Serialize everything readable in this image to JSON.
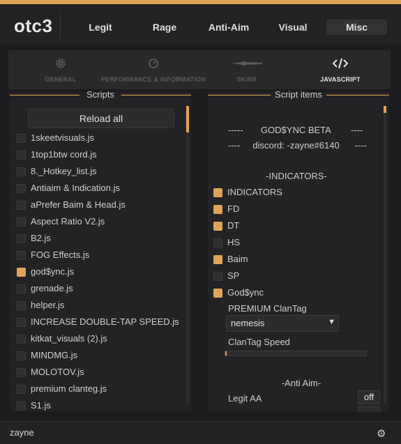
{
  "app": {
    "name": "otc3",
    "accent": "#e0a458"
  },
  "tabs": [
    {
      "label": "Legit"
    },
    {
      "label": "Rage"
    },
    {
      "label": "Anti-Aim"
    },
    {
      "label": "Visual"
    },
    {
      "label": "Misc",
      "active": true
    }
  ],
  "subnav": [
    {
      "label": "GENERAL",
      "icon": "gear-icon"
    },
    {
      "label": "PERFORMANCE & INFORMATION",
      "icon": "gauge-icon"
    },
    {
      "label": "SKINS",
      "icon": "knife-icon"
    },
    {
      "label": "JAVASCRIPT",
      "icon": "code-icon",
      "active": true
    }
  ],
  "scripts_panel": {
    "title": "Scripts",
    "reload_label": "Reload all",
    "scroll_position": 0.0,
    "items": [
      {
        "label": "1skeetvisuals.js",
        "checked": false
      },
      {
        "label": "1top1btw cord.js",
        "checked": false
      },
      {
        "label": "8._Hotkey_list.js",
        "checked": false
      },
      {
        "label": "Antiaim & Indication.js",
        "checked": false
      },
      {
        "label": "aPrefer Baim & Head.js",
        "checked": false
      },
      {
        "label": "Aspect Ratio V2.js",
        "checked": false
      },
      {
        "label": "B2.js",
        "checked": false
      },
      {
        "label": "FOG Effects.js",
        "checked": false
      },
      {
        "label": "god$ync.js",
        "checked": true
      },
      {
        "label": "grenade.js",
        "checked": false
      },
      {
        "label": "helper.js",
        "checked": false
      },
      {
        "label": "INCREASE DOUBLE-TAP SPEED.js",
        "checked": false
      },
      {
        "label": "kitkat_visuals (2).js",
        "checked": false
      },
      {
        "label": "MINDMG.js",
        "checked": false
      },
      {
        "label": "MOLOTOV.js",
        "checked": false
      },
      {
        "label": "premium clanteg.js",
        "checked": false
      },
      {
        "label": "S1.js",
        "checked": false
      }
    ]
  },
  "items_panel": {
    "title": "Script items",
    "header_line1": "-----       GOD$YNC BETA        ----",
    "header_line2": "----     discord: -zayne#6140      ----",
    "indicators_header": "-INDICATORS-",
    "indicators": [
      {
        "label": "INDICATORS",
        "checked": true
      },
      {
        "label": "FD",
        "checked": true
      },
      {
        "label": "DT",
        "checked": true
      },
      {
        "label": "HS",
        "checked": false
      },
      {
        "label": "Baim",
        "checked": true
      },
      {
        "label": "SP",
        "checked": false
      },
      {
        "label": "God$ync",
        "checked": true
      }
    ],
    "clantag_label": "PREMIUM ClanTag",
    "clantag_value": "nemesis",
    "speed_label": "ClanTag Speed",
    "speed_value": 0.01,
    "antiaim_header": "-Anti Aim-",
    "legit_aa_label": "Legit AA",
    "legit_aa_value": "off"
  },
  "footer": {
    "username": "zayne"
  }
}
